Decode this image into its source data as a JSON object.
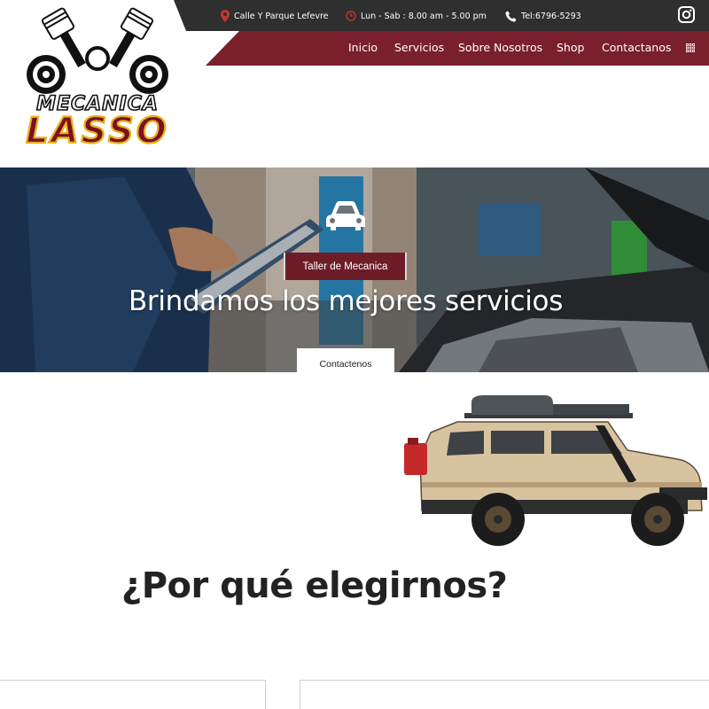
{
  "topbar": {
    "address": "Calle Y Parque Lefevre",
    "hours": "Lun - Sab : 8.00 am - 5.00 pm",
    "phone": "Tel:6796-5293",
    "icons": [
      "location-pin-icon",
      "clock-icon",
      "phone-icon",
      "instagram-icon"
    ],
    "accent_color": "#c0392b"
  },
  "nav": {
    "items": [
      "Inicio",
      "Servicios",
      "Sobre Nosotros",
      "Shop",
      "Contactanos"
    ],
    "bar_color": "#7a1f2c"
  },
  "logo": {
    "line1": "MECANICA",
    "line2": "LASSO"
  },
  "hero": {
    "tag": "Taller de Mecanica",
    "title": "Brindamos los mejores servicios",
    "button": "Contactenos",
    "tag_color": "#6f1c29"
  },
  "section": {
    "title": "¿Por qué elegirnos?"
  }
}
